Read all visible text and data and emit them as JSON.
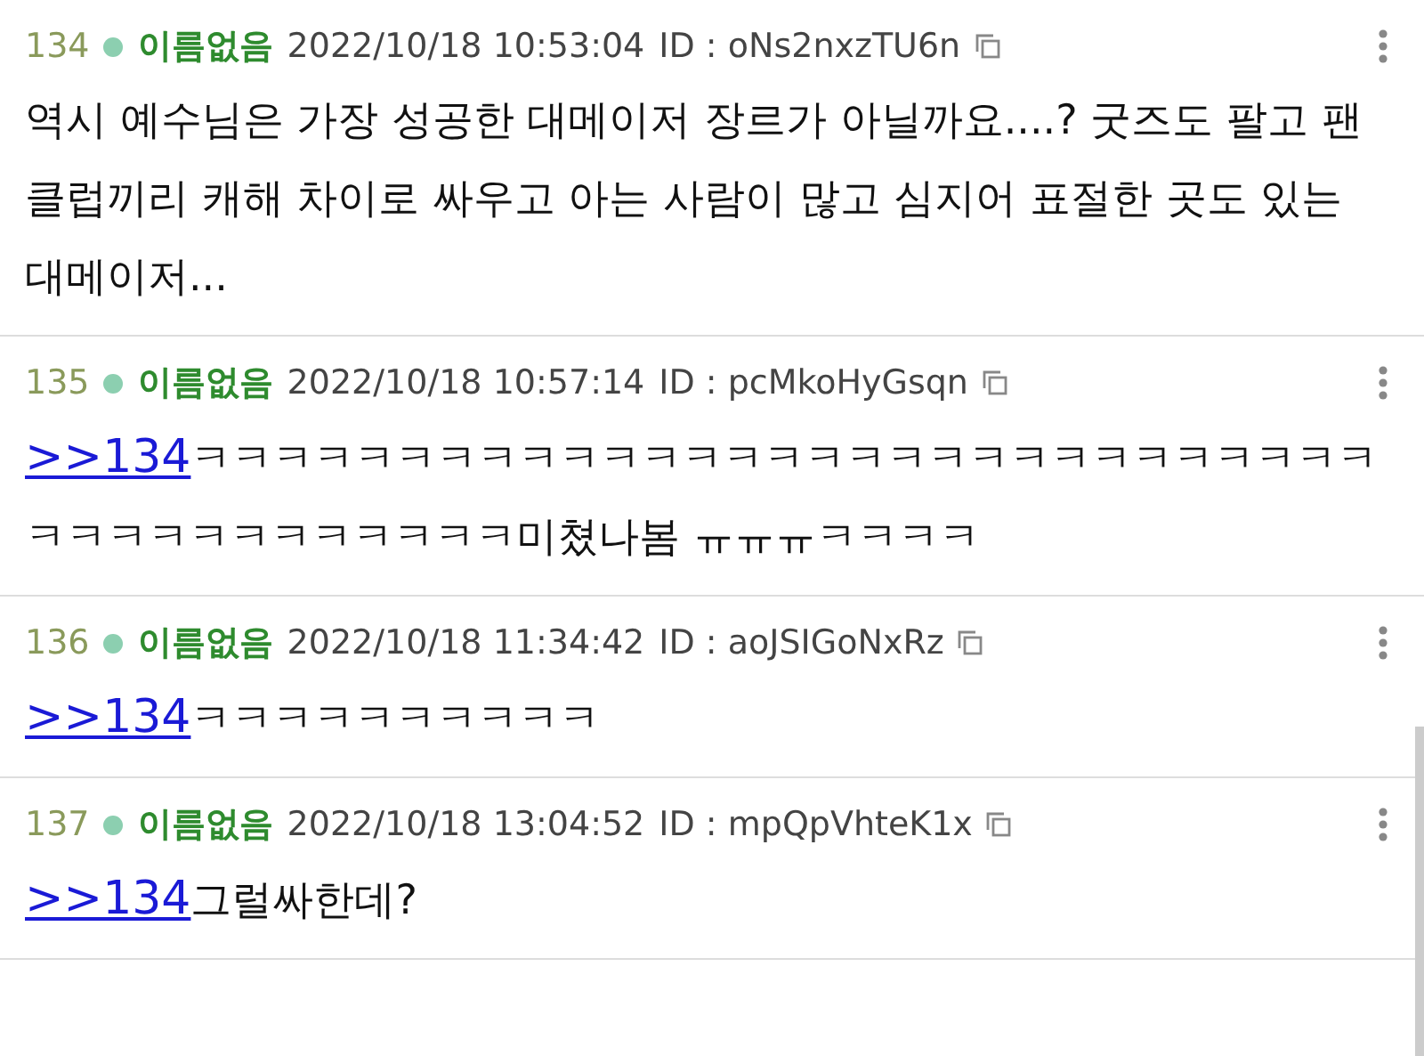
{
  "posts": [
    {
      "number": "134",
      "name": "이름없음",
      "date": "2022/10/18 10:53:04",
      "id_label": "ID : oNs2nxzTU6n",
      "text": "역시 예수님은 가장 성공한 대메이저 장르가 아닐까요....? 굿즈도 팔고 팬클럽끼리 캐해 차이로 싸우고 아는 사람이 많고 심지어 표절한 곳도 있는 대메이저..."
    },
    {
      "number": "135",
      "name": "이름없음",
      "date": "2022/10/18 10:57:14",
      "id_label": "ID : pcMkoHyGsqn",
      "reply_to": ">>134",
      "text": "ㅋㅋㅋㅋㅋㅋㅋㅋㅋㅋㅋㅋㅋㅋㅋㅋㅋㅋㅋㅋㅋㅋㅋㅋㅋㅋㅋㅋㅋㅋㅋㅋㅋㅋㅋㅋㅋㅋㅋㅋㅋ미쳤나봄 ㅠㅠㅠㅋㅋㅋㅋ"
    },
    {
      "number": "136",
      "name": "이름없음",
      "date": "2022/10/18 11:34:42",
      "id_label": "ID : aoJSIGoNxRz",
      "reply_to": ">>134",
      "text": "ㅋㅋㅋㅋㅋㅋㅋㅋㅋㅋ"
    },
    {
      "number": "137",
      "name": "이름없음",
      "date": "2022/10/18 13:04:52",
      "id_label": "ID : mpQpVhteK1x",
      "reply_to": ">>134",
      "text": "그럴싸한데?"
    }
  ]
}
